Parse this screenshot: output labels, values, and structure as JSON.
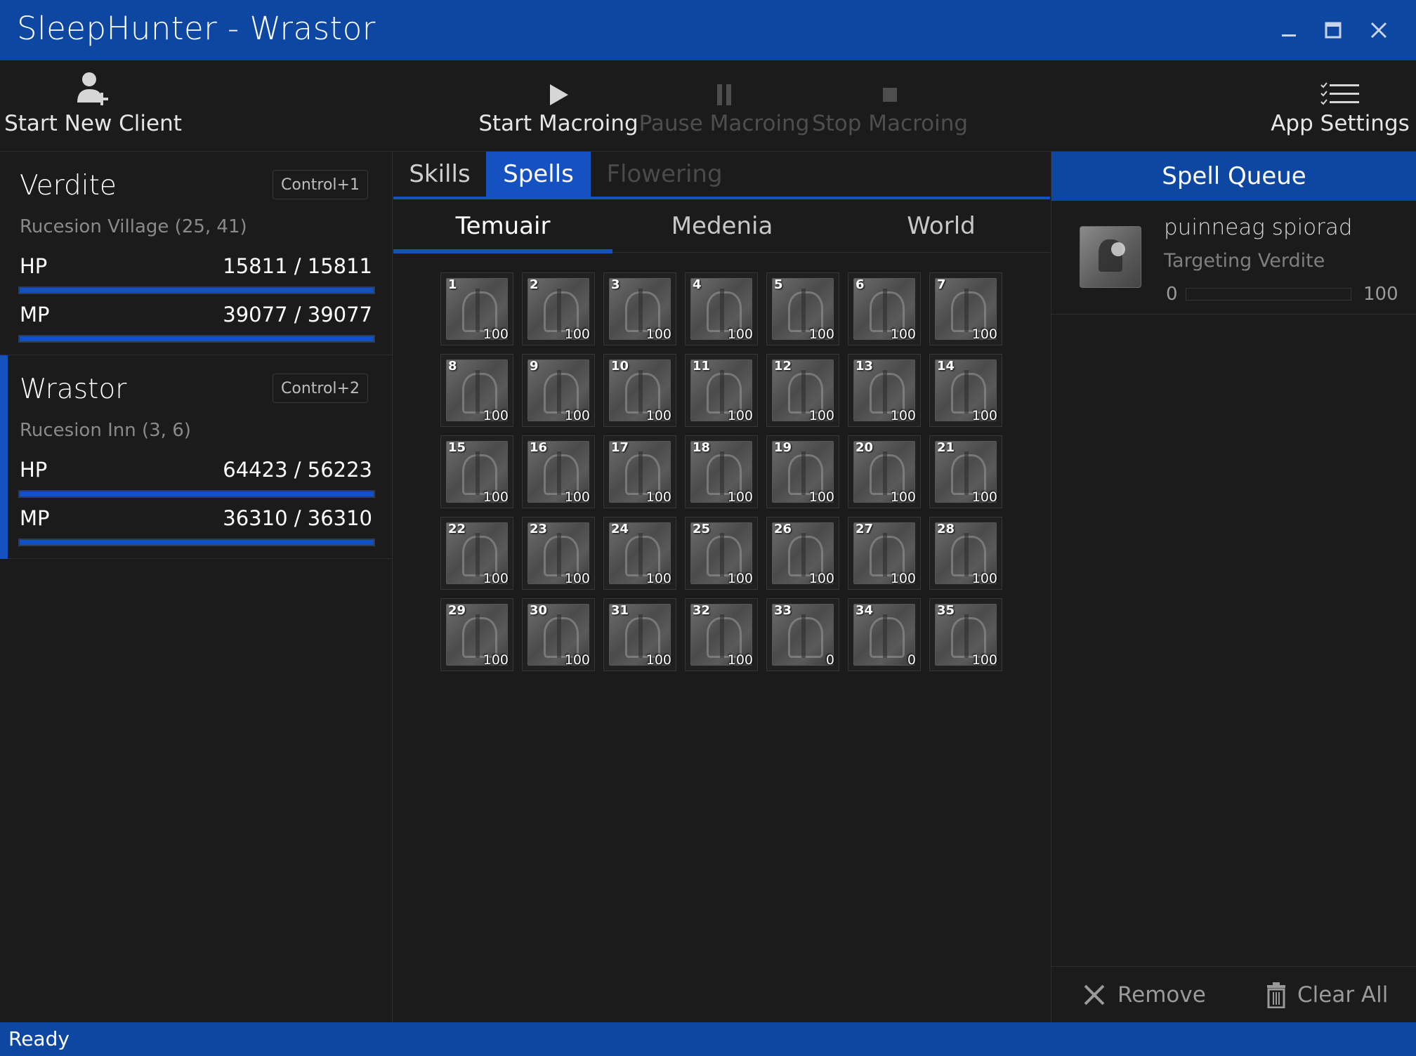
{
  "window": {
    "title": "SleepHunter - Wrastor"
  },
  "toolbar": {
    "new_client": "Start New Client",
    "start": "Start Macroing",
    "pause": "Pause Macroing",
    "stop": "Stop Macroing",
    "settings": "App Settings"
  },
  "clients": [
    {
      "name": "Verdite",
      "hotkey": "Control+1",
      "location": "Rucesion Village (25, 41)",
      "hp_label": "HP",
      "hp_text": "15811 / 15811",
      "hp_fraction": 1.0,
      "mp_label": "MP",
      "mp_text": "39077 / 39077",
      "mp_fraction": 1.0
    },
    {
      "name": "Wrastor",
      "hotkey": "Control+2",
      "location": "Rucesion Inn (3, 6)",
      "hp_label": "HP",
      "hp_text": "64423 / 56223",
      "hp_fraction": 1.0,
      "mp_label": "MP",
      "mp_text": "36310 / 36310",
      "mp_fraction": 1.0
    }
  ],
  "tabs": {
    "skills": "Skills",
    "spells": "Spells",
    "flowering": "Flowering"
  },
  "subtabs": {
    "temuair": "Temuair",
    "medenia": "Medenia",
    "world": "World"
  },
  "spells": [
    {
      "num": "1",
      "count": "100"
    },
    {
      "num": "2",
      "count": "100"
    },
    {
      "num": "3",
      "count": "100"
    },
    {
      "num": "4",
      "count": "100"
    },
    {
      "num": "5",
      "count": "100"
    },
    {
      "num": "6",
      "count": "100"
    },
    {
      "num": "7",
      "count": "100"
    },
    {
      "num": "8",
      "count": "100"
    },
    {
      "num": "9",
      "count": "100"
    },
    {
      "num": "10",
      "count": "100"
    },
    {
      "num": "11",
      "count": "100"
    },
    {
      "num": "12",
      "count": "100"
    },
    {
      "num": "13",
      "count": "100"
    },
    {
      "num": "14",
      "count": "100"
    },
    {
      "num": "15",
      "count": "100"
    },
    {
      "num": "16",
      "count": "100"
    },
    {
      "num": "17",
      "count": "100"
    },
    {
      "num": "18",
      "count": "100"
    },
    {
      "num": "19",
      "count": "100"
    },
    {
      "num": "20",
      "count": "100"
    },
    {
      "num": "21",
      "count": "100"
    },
    {
      "num": "22",
      "count": "100"
    },
    {
      "num": "23",
      "count": "100"
    },
    {
      "num": "24",
      "count": "100"
    },
    {
      "num": "25",
      "count": "100"
    },
    {
      "num": "26",
      "count": "100"
    },
    {
      "num": "27",
      "count": "100"
    },
    {
      "num": "28",
      "count": "100"
    },
    {
      "num": "29",
      "count": "100"
    },
    {
      "num": "30",
      "count": "100"
    },
    {
      "num": "31",
      "count": "100"
    },
    {
      "num": "32",
      "count": "100"
    },
    {
      "num": "33",
      "count": "0"
    },
    {
      "num": "34",
      "count": "0"
    },
    {
      "num": "35",
      "count": "100"
    }
  ],
  "queue": {
    "header": "Spell Queue",
    "items": [
      {
        "name": "puinneag spiorad",
        "target": "Targeting Verdite",
        "min": "0",
        "max": "100",
        "progress_fraction": 0.0
      }
    ],
    "remove": "Remove",
    "clear_all": "Clear All"
  },
  "status": {
    "text": "Ready"
  },
  "colors": {
    "accent": "#0d47a1",
    "tab_active": "#1551c0",
    "bar_fill": "#1151c4",
    "background": "#1b1b1b"
  }
}
